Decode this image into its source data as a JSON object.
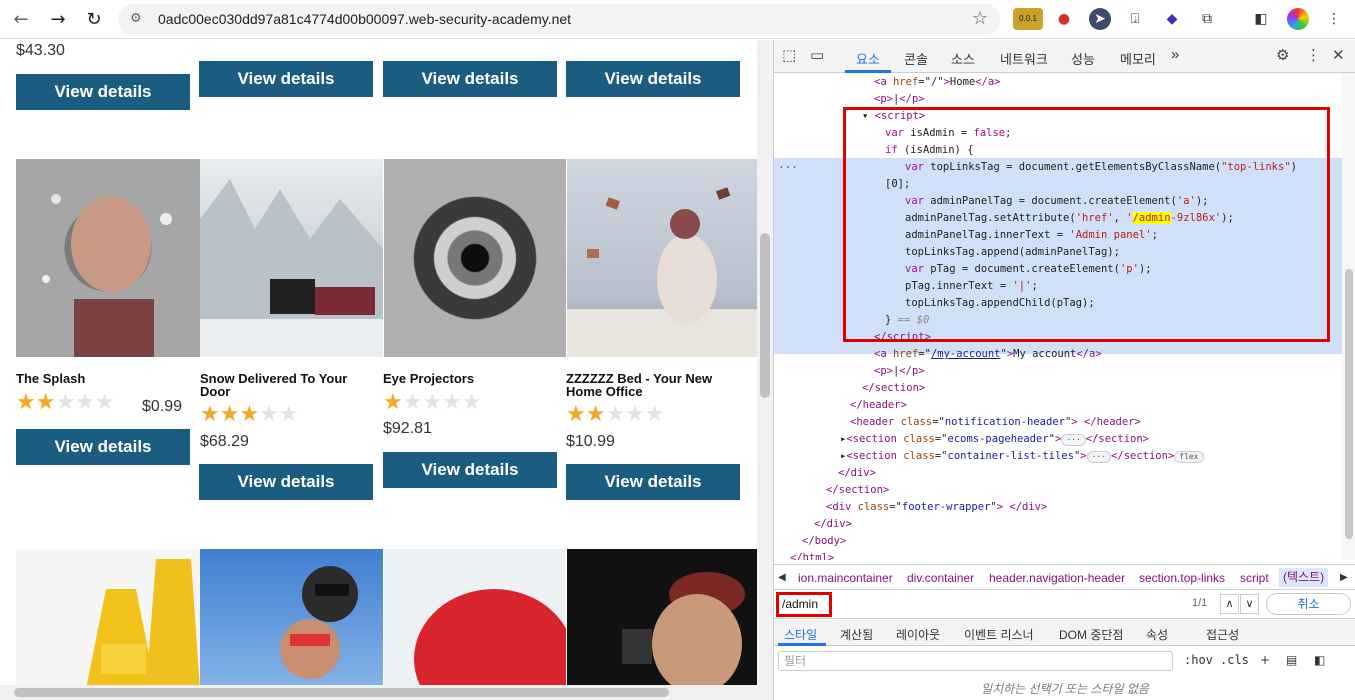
{
  "browser": {
    "url": "0adc00ec030dd97a81c4774d00b00097.web-security-academy.net",
    "ext_badge": "0.0.1"
  },
  "page": {
    "top_row": {
      "first_price": "$43.30",
      "button_label": "View details"
    },
    "products": [
      {
        "name": "The Splash",
        "price": "$0.99",
        "rating": 2
      },
      {
        "name": "Snow Delivered To Your Door",
        "price": "$68.29",
        "rating": 3
      },
      {
        "name": "Eye Projectors",
        "price": "$92.81",
        "rating": 1
      },
      {
        "name": "ZZZZZZ Bed - Your New Home Office",
        "price": "$10.99",
        "rating": 2
      }
    ],
    "button_label": "View details"
  },
  "devtools": {
    "tabs": [
      "요소",
      "콘솔",
      "소스",
      "네트워크",
      "성능",
      "메모리",
      "»"
    ],
    "code_lines": [
      {
        "indent": 100,
        "html": "<span class=\"tag\">&lt;a</span> <span class=\"attr\">href</span>=\"<span class=\"val\">/</span>\"<span class=\"tag\">&gt;</span>Home<span class=\"tag\">&lt;/a&gt;</span>"
      },
      {
        "indent": 100,
        "html": "<span class=\"tag\">&lt;p&gt;</span>|<span class=\"tag\">&lt;/p&gt;</span>"
      },
      {
        "indent": 88,
        "html": "▾ <span class=\"tag\">&lt;script&gt;</span>"
      },
      {
        "indent": 111,
        "html": "<span class=\"kw\">var</span> isAdmin = <span class=\"kw\">false</span>;"
      },
      {
        "indent": 111,
        "html": "<span class=\"kw\">if</span> (isAdmin) {"
      },
      {
        "indent": 131,
        "html": "<span class=\"kw\">var</span> topLinksTag = document.getElementsByClassName(<span class=\"str\">\"top-links\"</span>)"
      },
      {
        "indent": 111,
        "html": "[0];"
      },
      {
        "indent": 131,
        "html": "<span class=\"kw\">var</span> adminPanelTag = document.createElement(<span class=\"str\">'a'</span>);"
      },
      {
        "indent": 131,
        "html": "adminPanelTag.setAttribute(<span class=\"str\">'href'</span>, <span class=\"str\">'<span class=\"hl\">/admin</span>-9zl86x'</span>);"
      },
      {
        "indent": 131,
        "html": "adminPanelTag.innerText = <span class=\"str\">'Admin panel'</span>;"
      },
      {
        "indent": 131,
        "html": "topLinksTag.append(adminPanelTag);"
      },
      {
        "indent": 131,
        "html": "<span class=\"kw\">var</span> pTag = document.createElement(<span class=\"str\">'p'</span>);"
      },
      {
        "indent": 131,
        "html": "pTag.innerText = <span class=\"str\">'|'</span>;"
      },
      {
        "indent": 131,
        "html": "topLinksTag.appendChild(pTag);"
      },
      {
        "indent": 111,
        "html": "} <span class=\"dim\">== $0</span>"
      },
      {
        "indent": 100,
        "html": "<span class=\"tag\">&lt;/script&gt;</span>"
      },
      {
        "indent": 100,
        "html": "<span class=\"tag\">&lt;a</span> <span class=\"attr\">href</span>=\"<span class=\"val\"><u>/my-account</u></span>\"<span class=\"tag\">&gt;</span>My account<span class=\"tag\">&lt;/a&gt;</span>"
      },
      {
        "indent": 100,
        "html": "<span class=\"tag\">&lt;p&gt;</span>|<span class=\"tag\">&lt;/p&gt;</span>"
      },
      {
        "indent": 88,
        "html": "<span class=\"tag\">&lt;/section&gt;</span>"
      },
      {
        "indent": 76,
        "html": "<span class=\"tag\">&lt;/header&gt;</span>"
      },
      {
        "indent": 76,
        "html": "<span class=\"tag\">&lt;header</span> <span class=\"attr\">class</span>=\"<span class=\"val\">notification-header</span>\"<span class=\"tag\">&gt;</span> <span class=\"tag\">&lt;/header&gt;</span>"
      },
      {
        "indent": 66,
        "html": "▸<span class=\"tag\">&lt;section</span> <span class=\"attr\">class</span>=\"<span class=\"val\">ecoms-pageheader</span>\"<span class=\"tag\">&gt;</span><span class=\"badge\">···</span><span class=\"tag\">&lt;/section&gt;</span>"
      },
      {
        "indent": 66,
        "html": "▸<span class=\"tag\">&lt;section</span> <span class=\"attr\">class</span>=\"<span class=\"val\">container-list-tiles</span>\"<span class=\"tag\">&gt;</span><span class=\"badge\">···</span><span class=\"tag\">&lt;/section&gt;</span><span class=\"badge\">flex</span>"
      },
      {
        "indent": 64,
        "html": "<span class=\"tag\">&lt;/div&gt;</span>"
      },
      {
        "indent": 52,
        "html": "<span class=\"tag\">&lt;/section&gt;</span>"
      },
      {
        "indent": 52,
        "html": "<span class=\"tag\">&lt;div</span> <span class=\"attr\">class</span>=\"<span class=\"val\">footer-wrapper</span>\"<span class=\"tag\">&gt;</span> <span class=\"tag\">&lt;/div&gt;</span>"
      },
      {
        "indent": 40,
        "html": "<span class=\"tag\">&lt;/div&gt;</span>"
      },
      {
        "indent": 28,
        "html": "<span class=\"tag\">&lt;/body&gt;</span>"
      },
      {
        "indent": 16,
        "html": "<span class=\"tag\">&lt;/html&gt;</span>"
      }
    ],
    "breadcrumbs": [
      "ion.maincontainer",
      "div.container",
      "header.navigation-header",
      "section.top-links",
      "script",
      "(텍스트)"
    ],
    "search": {
      "query": "/admin",
      "count": "1/1",
      "cancel": "취소"
    },
    "styles_tabs": [
      "스타일",
      "계산됨",
      "레이아웃",
      "이벤트 리스너",
      "DOM 중단점",
      "속성",
      "접근성"
    ],
    "filter_placeholder": "필터",
    "filter_tools": [
      ":hov",
      ".cls"
    ],
    "no_match": "일치하는 선택기 또는 스타일 없음"
  }
}
